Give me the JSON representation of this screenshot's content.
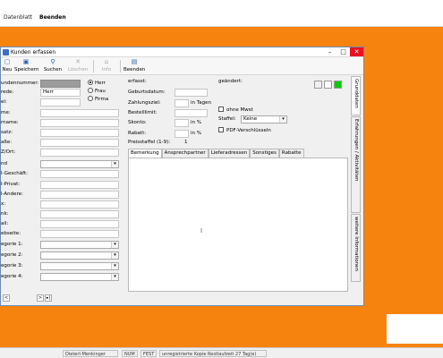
{
  "app": {
    "menu": [
      "Datenblatt",
      "Beenden"
    ]
  },
  "dialog": {
    "title": "Kunden erfassen",
    "toolbar": [
      {
        "label": "Neu",
        "icon": "new-doc-icon",
        "glyph": "▢"
      },
      {
        "label": "Speichern",
        "icon": "save-icon",
        "glyph": "▣"
      },
      {
        "label": "Suchen",
        "icon": "search-icon",
        "glyph": "⚲"
      },
      {
        "label": "Löschen",
        "icon": "delete-icon",
        "glyph": "✕"
      },
      {
        "label": "Info",
        "icon": "info-icon",
        "glyph": "⌂"
      },
      {
        "label": "Beenden",
        "icon": "exit-icon",
        "glyph": "▤"
      }
    ],
    "left_fields": [
      "undennummer:",
      "rede:",
      "el:",
      "me:",
      "rname:",
      "satz:",
      "aße:",
      "Z/Ort:",
      "nd",
      "l-Geschäft:",
      "l-Privat:",
      "l-Andere:",
      "x:",
      "nk:",
      "ail:",
      "ebseite:"
    ],
    "anrede_value": "Herr",
    "categories": [
      "egorie 1:",
      "egorie 2:",
      "egorie 3:",
      "egorie 4:"
    ],
    "radio": {
      "options": [
        "Herr",
        "Frau",
        "Firma"
      ],
      "selected": "Herr"
    },
    "erfasst_label": "erfasst:",
    "geaendert_label": "geändert:",
    "middle_fields": {
      "geburtsdatum": "Geburtsdatum:",
      "zahlungsziel": "Zahlungsziel:",
      "zahlungsziel_unit": "in Tagen",
      "bestelllimit": "Bestelllimit:",
      "skonto": "Skonto:",
      "skonto_unit": "in %",
      "rabatt": "Rabatt:",
      "rabatt_unit": "in %",
      "preisstaffel": "Preisstaffel (1-9):",
      "preisstaffel_value": "1"
    },
    "ohne_mwst": "ohne Mwst",
    "staffel_label": "Staffel:",
    "staffel_value": "Keine",
    "pdf_label": "PDF-Verschlüsseln",
    "colors": [
      "#f0f0f0",
      "#ffffff",
      "#00cc00"
    ],
    "tabs": [
      "Bemerkung",
      "Ansprechpartner",
      "Lieferadressen",
      "Sonstiges",
      "Rabatte"
    ],
    "active_tab": "Bemerkung",
    "vertical_tabs": [
      "Grunddaten",
      "Erfahrungen / Aktivitäten",
      "weitere Informationen"
    ],
    "nav_buttons": [
      "<",
      ">",
      "▸|"
    ]
  },
  "statusbar": {
    "cells": [
      "Dieterl-Menkinger",
      "NUM",
      "FEST",
      "unregistrierte Kopie Restlaufzeit 27 Tag(e)"
    ]
  }
}
